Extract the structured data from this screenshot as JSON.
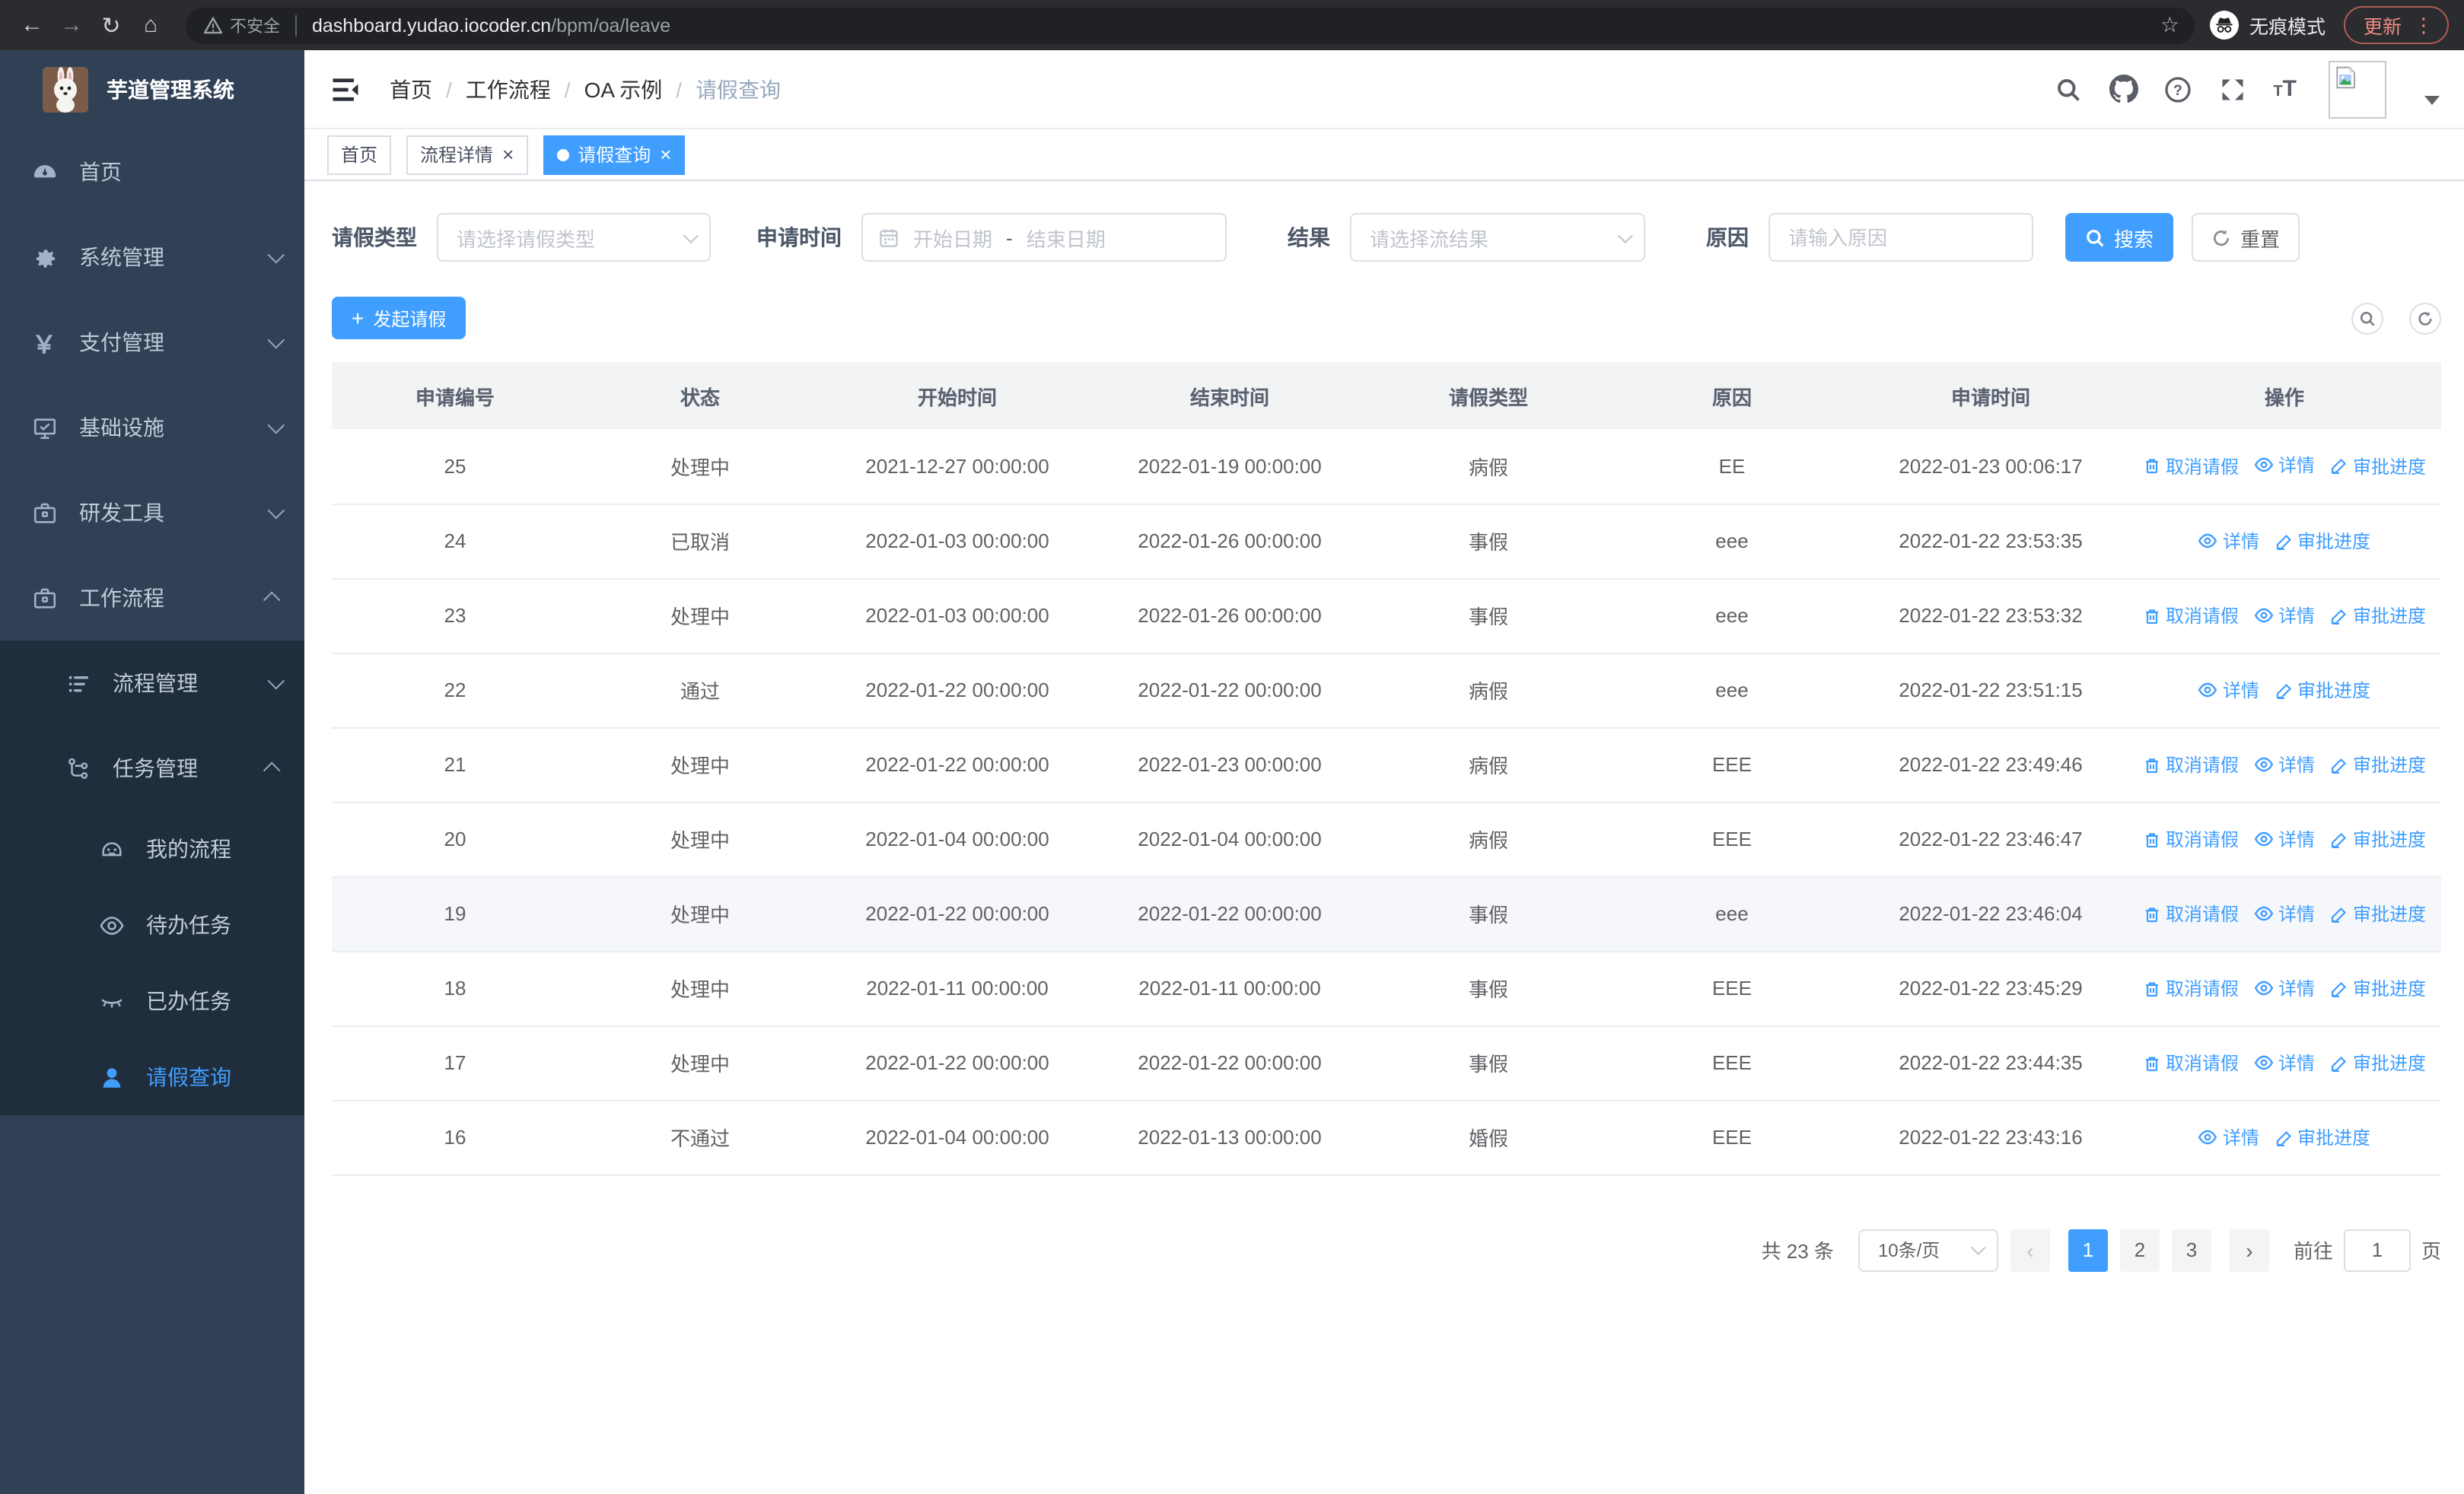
{
  "browser": {
    "security_text": "不安全",
    "url_host": "dashboard.yudao.iocoder.cn",
    "url_path": "/bpm/oa/leave",
    "incognito_label": "无痕模式",
    "update_label": "更新"
  },
  "sidebar": {
    "app_title": "芋道管理系统",
    "items": [
      {
        "label": "首页",
        "icon": "dashboard-icon",
        "level": 1,
        "in_sub": false,
        "chevron": "",
        "active": false
      },
      {
        "label": "系统管理",
        "icon": "gear-icon",
        "level": 1,
        "in_sub": false,
        "chevron": "down",
        "active": false
      },
      {
        "label": "支付管理",
        "icon": "yen-icon",
        "level": 1,
        "in_sub": false,
        "chevron": "down",
        "active": false
      },
      {
        "label": "基础设施",
        "icon": "monitor-icon",
        "level": 1,
        "in_sub": false,
        "chevron": "down",
        "active": false
      },
      {
        "label": "研发工具",
        "icon": "toolbox-icon",
        "level": 1,
        "in_sub": false,
        "chevron": "down",
        "active": false
      },
      {
        "label": "工作流程",
        "icon": "briefcase-icon",
        "level": 1,
        "in_sub": false,
        "chevron": "up",
        "active": false
      },
      {
        "label": "流程管理",
        "icon": "list-icon",
        "level": 2,
        "in_sub": true,
        "chevron": "down",
        "active": false
      },
      {
        "label": "任务管理",
        "icon": "tree-icon",
        "level": 2,
        "in_sub": true,
        "chevron": "up",
        "active": false
      },
      {
        "label": "我的流程",
        "icon": "robot-icon",
        "level": 3,
        "in_sub": true,
        "chevron": "",
        "active": false
      },
      {
        "label": "待办任务",
        "icon": "eye-open-icon",
        "level": 3,
        "in_sub": true,
        "chevron": "",
        "active": false
      },
      {
        "label": "已办任务",
        "icon": "eye-closed-icon",
        "level": 3,
        "in_sub": true,
        "chevron": "",
        "active": false
      },
      {
        "label": "请假查询",
        "icon": "user-icon",
        "level": 3,
        "in_sub": true,
        "chevron": "",
        "active": true
      }
    ]
  },
  "header": {
    "breadcrumb": [
      "首页",
      "工作流程",
      "OA 示例",
      "请假查询"
    ],
    "font_size_icon_text": "tT"
  },
  "tabs": [
    {
      "label": "首页",
      "closable": false,
      "active": false
    },
    {
      "label": "流程详情",
      "closable": true,
      "active": false
    },
    {
      "label": "请假查询",
      "closable": true,
      "active": true
    }
  ],
  "filters": {
    "leave_type": {
      "label": "请假类型",
      "placeholder": "请选择请假类型"
    },
    "apply_time": {
      "label": "申请时间",
      "start_placeholder": "开始日期",
      "separator": "-",
      "end_placeholder": "结束日期"
    },
    "result": {
      "label": "结果",
      "placeholder": "请选择流结果"
    },
    "reason": {
      "label": "原因",
      "placeholder": "请输入原因"
    },
    "search_label": "搜索",
    "reset_label": "重置"
  },
  "toolbar": {
    "create_label": "发起请假"
  },
  "table": {
    "columns": [
      "申请编号",
      "状态",
      "开始时间",
      "结束时间",
      "请假类型",
      "原因",
      "申请时间",
      "操作"
    ],
    "action_labels": {
      "cancel": "取消请假",
      "detail": "详情",
      "progress": "审批进度"
    },
    "rows": [
      {
        "id": "25",
        "status": "处理中",
        "start": "2021-12-27 00:00:00",
        "end": "2022-01-19 00:00:00",
        "type": "病假",
        "reason": "EE",
        "applied": "2022-01-23 00:06:17",
        "actions": [
          "cancel",
          "detail",
          "progress"
        ],
        "highlight": false
      },
      {
        "id": "24",
        "status": "已取消",
        "start": "2022-01-03 00:00:00",
        "end": "2022-01-26 00:00:00",
        "type": "事假",
        "reason": "eee",
        "applied": "2022-01-22 23:53:35",
        "actions": [
          "detail",
          "progress"
        ],
        "highlight": false
      },
      {
        "id": "23",
        "status": "处理中",
        "start": "2022-01-03 00:00:00",
        "end": "2022-01-26 00:00:00",
        "type": "事假",
        "reason": "eee",
        "applied": "2022-01-22 23:53:32",
        "actions": [
          "cancel",
          "detail",
          "progress"
        ],
        "highlight": false
      },
      {
        "id": "22",
        "status": "通过",
        "start": "2022-01-22 00:00:00",
        "end": "2022-01-22 00:00:00",
        "type": "病假",
        "reason": "eee",
        "applied": "2022-01-22 23:51:15",
        "actions": [
          "detail",
          "progress"
        ],
        "highlight": false
      },
      {
        "id": "21",
        "status": "处理中",
        "start": "2022-01-22 00:00:00",
        "end": "2022-01-23 00:00:00",
        "type": "病假",
        "reason": "EEE",
        "applied": "2022-01-22 23:49:46",
        "actions": [
          "cancel",
          "detail",
          "progress"
        ],
        "highlight": false
      },
      {
        "id": "20",
        "status": "处理中",
        "start": "2022-01-04 00:00:00",
        "end": "2022-01-04 00:00:00",
        "type": "病假",
        "reason": "EEE",
        "applied": "2022-01-22 23:46:47",
        "actions": [
          "cancel",
          "detail",
          "progress"
        ],
        "highlight": false
      },
      {
        "id": "19",
        "status": "处理中",
        "start": "2022-01-22 00:00:00",
        "end": "2022-01-22 00:00:00",
        "type": "事假",
        "reason": "eee",
        "applied": "2022-01-22 23:46:04",
        "actions": [
          "cancel",
          "detail",
          "progress"
        ],
        "highlight": true
      },
      {
        "id": "18",
        "status": "处理中",
        "start": "2022-01-11 00:00:00",
        "end": "2022-01-11 00:00:00",
        "type": "事假",
        "reason": "EEE",
        "applied": "2022-01-22 23:45:29",
        "actions": [
          "cancel",
          "detail",
          "progress"
        ],
        "highlight": false
      },
      {
        "id": "17",
        "status": "处理中",
        "start": "2022-01-22 00:00:00",
        "end": "2022-01-22 00:00:00",
        "type": "事假",
        "reason": "EEE",
        "applied": "2022-01-22 23:44:35",
        "actions": [
          "cancel",
          "detail",
          "progress"
        ],
        "highlight": false
      },
      {
        "id": "16",
        "status": "不通过",
        "start": "2022-01-04 00:00:00",
        "end": "2022-01-13 00:00:00",
        "type": "婚假",
        "reason": "EEE",
        "applied": "2022-01-22 23:43:16",
        "actions": [
          "detail",
          "progress"
        ],
        "highlight": false
      }
    ]
  },
  "pagination": {
    "total_label": "共 23 条",
    "page_size_label": "10条/页",
    "pages": [
      "1",
      "2",
      "3"
    ],
    "active_page": "1",
    "goto_label": "前往",
    "goto_value": "1",
    "page_unit_label": "页"
  },
  "colors": {
    "primary": "#409eff",
    "sidebar_bg": "#304156",
    "submenu_bg": "#1f2d3d",
    "danger_update": "#f28b82"
  }
}
